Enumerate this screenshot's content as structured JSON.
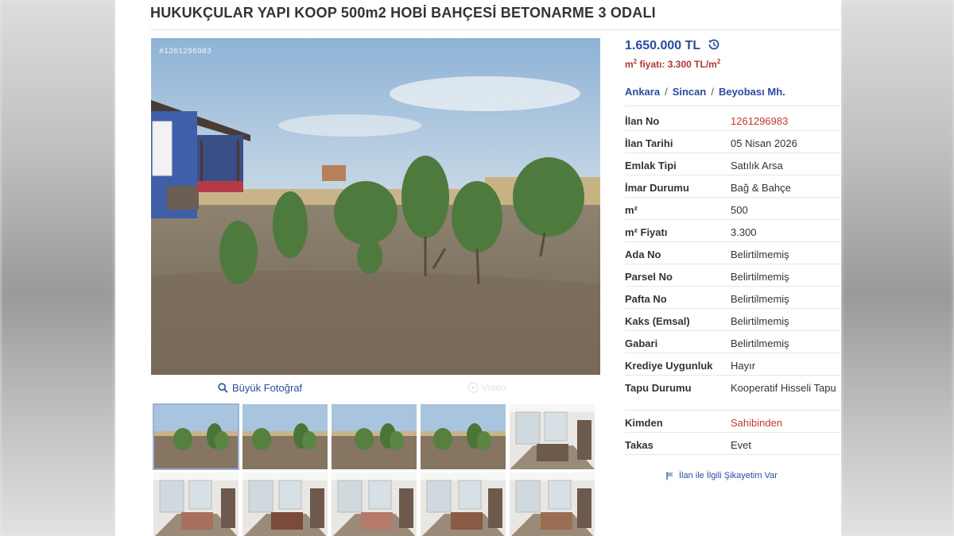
{
  "listing": {
    "title": "HUKUKÇULAR YAPI KOOP 500m2 HOBİ BAHÇESİ BETONARME 3 ODALI",
    "photo_id": "#1261296983",
    "big_photo_label": "Büyük Fotoğraf",
    "video_label": "Video",
    "thumbnails": [
      {
        "kind": "garden",
        "active": true
      },
      {
        "kind": "garden"
      },
      {
        "kind": "garden"
      },
      {
        "kind": "garden"
      },
      {
        "kind": "interior"
      },
      {
        "kind": "interior"
      },
      {
        "kind": "interior"
      },
      {
        "kind": "interior"
      },
      {
        "kind": "interior"
      },
      {
        "kind": "interior"
      }
    ]
  },
  "price": {
    "value": "1.650.000 TL",
    "m2_prefix": "m",
    "m2_sup": "2",
    "m2_text": " fiyatı: 3.300 TL/m",
    "m2_sup2": "2",
    "history_icon": "history-clock-icon"
  },
  "location": {
    "city": "Ankara",
    "district": "Sincan",
    "neighborhood": "Beyobası Mh.",
    "separator": "/"
  },
  "details": [
    {
      "key": "İlan No",
      "value": "1261296983",
      "red": true
    },
    {
      "key": "İlan Tarihi",
      "value": "05 Nisan 2026"
    },
    {
      "key": "Emlak Tipi",
      "value": "Satılık Arsa"
    },
    {
      "key": "İmar Durumu",
      "value": "Bağ & Bahçe"
    },
    {
      "key": "m²",
      "value": "500"
    },
    {
      "key": "m² Fiyatı",
      "value": "3.300"
    },
    {
      "key": "Ada No",
      "value": "Belirtilmemiş"
    },
    {
      "key": "Parsel No",
      "value": "Belirtilmemiş"
    },
    {
      "key": "Pafta No",
      "value": "Belirtilmemiş"
    },
    {
      "key": "Kaks (Emsal)",
      "value": "Belirtilmemiş"
    },
    {
      "key": "Gabari",
      "value": "Belirtilmemiş"
    },
    {
      "key": "Krediye Uygunluk",
      "value": "Hayır"
    },
    {
      "key": "Tapu Durumu",
      "value": "Kooperatif Hisseli Tapu",
      "tall": true
    },
    {
      "key": "Kimden",
      "value": "Sahibinden",
      "red": true
    },
    {
      "key": "Takas",
      "value": "Evet"
    }
  ],
  "complaint_label": "İlan ile İlgili Şikayetim Var",
  "colors": {
    "link": "#2a4b9e",
    "accent_red": "#c0392b"
  }
}
